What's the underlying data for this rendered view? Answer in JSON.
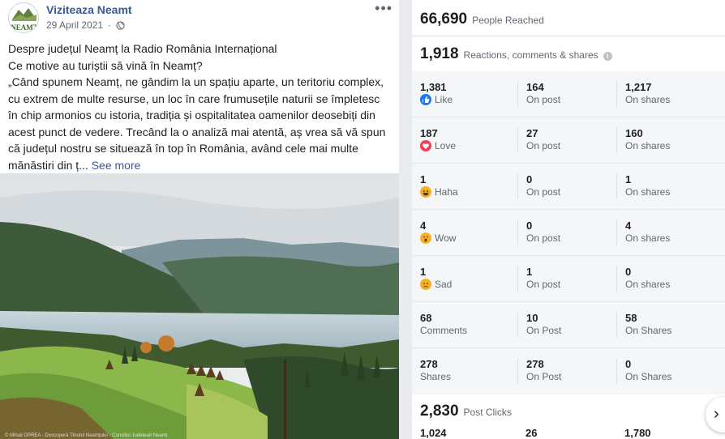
{
  "post": {
    "page_name": "Viziteaza Neamt",
    "avatar_text": "NEAMT",
    "date": "29 April 2021",
    "more_icon": "more-horizontal-icon",
    "text_lines": [
      "Despre județul Neamț la Radio România Internațional",
      "Ce motive au turiștii să vină în Neamț?",
      "„Când spunem Neamț, ne gândim la un spațiu aparte, un teritoriu complex, cu extrem de multe resurse, un loc în care frumusețile naturii se împletesc în chip armonios cu istoria, tradiția și ospitalitatea oamenilor deosebiți din acest punct de vedere. Trecând la o analiză mai atentă, aș vrea să vă spun că județul nostru se situează în top în România, având cele mai multe mănăstiri din ț..."
    ],
    "see_more": "See more",
    "photo_credit": "© Mihail OPREA - Descoperă Ținutul Neamțului - Consiliul Județean Neamț"
  },
  "insights": {
    "reach": {
      "value": "66,690",
      "label": "People Reached"
    },
    "engagement": {
      "value": "1,918",
      "label": "Reactions, comments & shares"
    },
    "rows": [
      {
        "total": "1,381",
        "label": "Like",
        "icon": "like-icon",
        "on_post": "164",
        "on_post_label": "On post",
        "on_shares": "1,217",
        "on_shares_label": "On shares"
      },
      {
        "total": "187",
        "label": "Love",
        "icon": "love-icon",
        "on_post": "27",
        "on_post_label": "On post",
        "on_shares": "160",
        "on_shares_label": "On shares"
      },
      {
        "total": "1",
        "label": "Haha",
        "icon": "haha-icon",
        "on_post": "0",
        "on_post_label": "On post",
        "on_shares": "1",
        "on_shares_label": "On shares"
      },
      {
        "total": "4",
        "label": "Wow",
        "icon": "wow-icon",
        "on_post": "0",
        "on_post_label": "On post",
        "on_shares": "4",
        "on_shares_label": "On shares"
      },
      {
        "total": "1",
        "label": "Sad",
        "icon": "sad-icon",
        "on_post": "1",
        "on_post_label": "On post",
        "on_shares": "0",
        "on_shares_label": "On shares"
      },
      {
        "total": "68",
        "label": "Comments",
        "icon": "",
        "on_post": "10",
        "on_post_label": "On Post",
        "on_shares": "58",
        "on_shares_label": "On Shares"
      },
      {
        "total": "278",
        "label": "Shares",
        "icon": "",
        "on_post": "278",
        "on_post_label": "On Post",
        "on_shares": "0",
        "on_shares_label": "On Shares"
      }
    ],
    "clicks": {
      "value": "2,830",
      "label": "Post Clicks"
    },
    "clicks_row": [
      "1,024",
      "26",
      "1,780"
    ]
  },
  "colors": {
    "link": "#385898",
    "like": "#1877f2",
    "love": "#f33e58",
    "reaction_yellow": "#f7b125"
  }
}
